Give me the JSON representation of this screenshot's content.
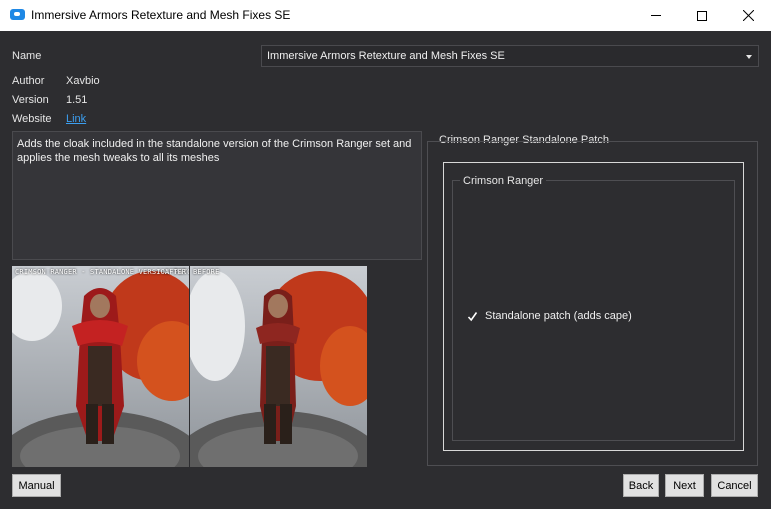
{
  "window": {
    "title": "Immersive Armors Retexture and Mesh Fixes SE",
    "icon": "app-icon"
  },
  "info": {
    "name_label": "Name",
    "name_value": "Immersive Armors Retexture and Mesh Fixes SE",
    "author_label": "Author",
    "author_value": "Xavbio",
    "version_label": "Version",
    "version_value": "1.51",
    "website_label": "Website",
    "website_link": "Link"
  },
  "description": "Adds the cloak included in the standalone version of the Crimson Ranger set and applies the mesh tweaks to all its meshes",
  "preview": {
    "left_caption": "CRIMSON RANGER - STANDALONE VERSION PATCH",
    "left_tag": "AFTER",
    "right_tag": "BEFORE"
  },
  "options": {
    "group_title": "Crimson Ranger Standalone Patch",
    "subgroup_title": "Crimson Ranger",
    "checkbox_label": "Standalone patch (adds cape)",
    "checkbox_checked": true
  },
  "buttons": {
    "manual": "Manual",
    "back": "Back",
    "next": "Next",
    "cancel": "Cancel"
  },
  "colors": {
    "background": "#2d2d30",
    "link": "#3c9ff0",
    "titlebar": "#ffffff"
  }
}
